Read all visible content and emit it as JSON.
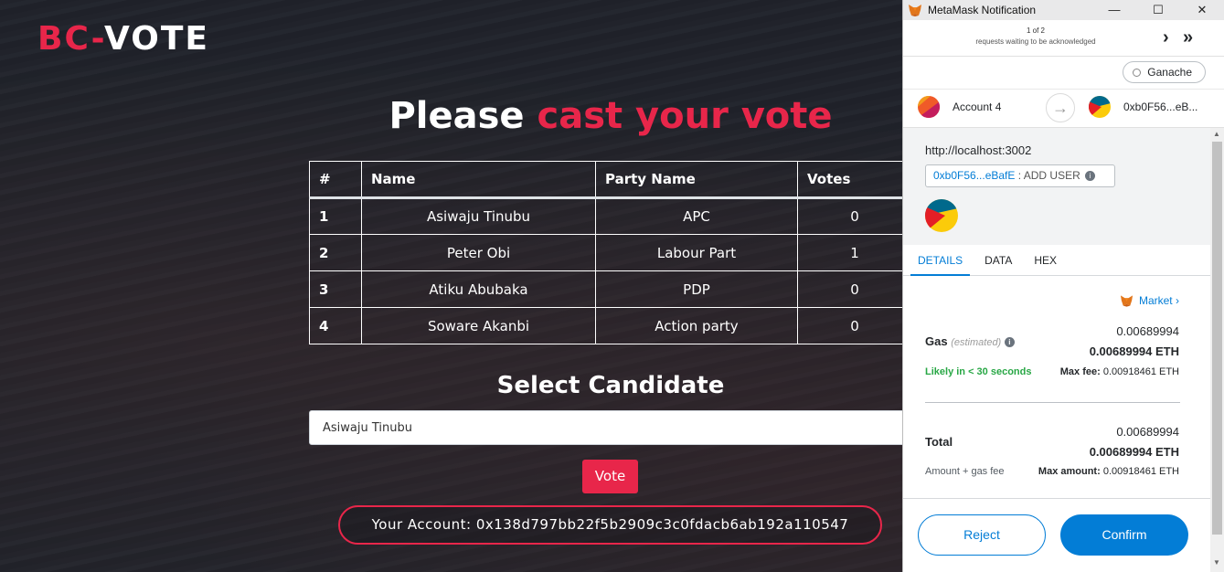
{
  "app": {
    "logo_prefix": "BC-",
    "logo_suffix": "VOTE",
    "heading_white": "Please ",
    "heading_red": "cast your vote",
    "table": {
      "headers": [
        "#",
        "Name",
        "Party Name",
        "Votes"
      ],
      "rows": [
        {
          "num": "1",
          "name": "Asiwaju Tinubu",
          "party": "APC",
          "votes": "0"
        },
        {
          "num": "2",
          "name": "Peter Obi",
          "party": "Labour Part",
          "votes": "1"
        },
        {
          "num": "3",
          "name": "Atiku Abubaka",
          "party": "PDP",
          "votes": "0"
        },
        {
          "num": "4",
          "name": "Soware Akanbi",
          "party": "Action party",
          "votes": "0"
        }
      ]
    },
    "select_title": "Select Candidate",
    "select_value": "Asiwaju Tinubu",
    "vote_button": "Vote",
    "account_text": "Your Account: 0x138d797bb22f5b2909c3c0fdacb6ab192a110547",
    "accent_color": "#e8264a"
  },
  "metamask": {
    "window_title": "MetaMask Notification",
    "window_controls": [
      "—",
      "☐",
      "✕"
    ],
    "queue_count": "1 of 2",
    "queue_text": "requests waiting to be acknowledged",
    "nav_next": "›",
    "nav_last": "»",
    "network": "Ganache",
    "from_account": "Account 4",
    "to_account": "0xb0F56...eB...",
    "origin": "http://localhost:3002",
    "address_chip_link": "0xb0F56...eBafE",
    "address_chip_action": " : ADD USER",
    "info_glyph": "i",
    "tabs": [
      "DETAILS",
      "DATA",
      "HEX"
    ],
    "market_label": "Market",
    "market_chevron": "›",
    "gas_label": "Gas",
    "gas_estimated": "(estimated)",
    "gas_value": "0.00689994",
    "gas_value_eth": "0.00689994 ETH",
    "likely_text": "Likely in < 30 seconds",
    "max_fee_label": "Max fee:",
    "max_fee_value": "0.00918461 ETH",
    "total_label": "Total",
    "total_value": "0.00689994",
    "total_value_eth": "0.00689994 ETH",
    "amount_gas_label": "Amount + gas fee",
    "max_amount_label": "Max amount:",
    "max_amount_value": "0.00918461 ETH",
    "reject_button": "Reject",
    "confirm_button": "Confirm",
    "primary_color": "#037dd6"
  }
}
